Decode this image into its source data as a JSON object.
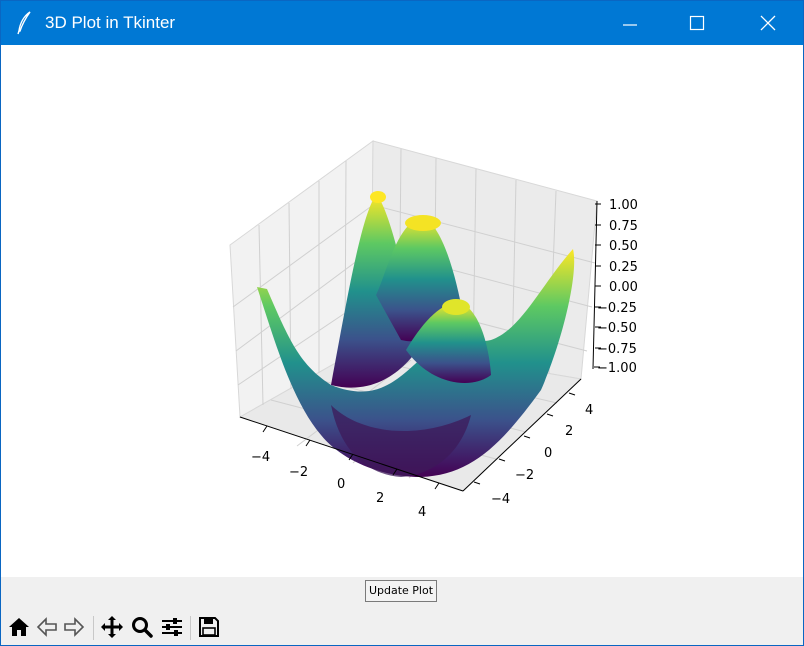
{
  "window": {
    "title": "3D Plot in Tkinter"
  },
  "colors": {
    "titlebar": "#0078d4",
    "viridis_low": "#440154",
    "viridis_mid": "#21918c",
    "viridis_high": "#fde725"
  },
  "plot": {
    "z_ticks": [
      "1.00",
      "0.75",
      "0.50",
      "0.25",
      "0.00",
      "−0.25",
      "−0.50",
      "−0.75",
      "−1.00"
    ],
    "x_ticks": [
      "−4",
      "−2",
      "0",
      "2",
      "4"
    ],
    "y_ticks": [
      "4",
      "2",
      "0",
      "−2",
      "−4"
    ]
  },
  "chart_data": {
    "type": "surface",
    "function": "z = sin(sqrt(x^2 + y^2))",
    "x_range": [
      -5,
      5
    ],
    "y_range": [
      -5,
      5
    ],
    "z_range": [
      -1,
      1
    ],
    "colormap": "viridis",
    "x_ticks": [
      -4,
      -2,
      0,
      2,
      4
    ],
    "y_ticks": [
      -4,
      -2,
      0,
      2,
      4
    ],
    "z_ticks": [
      -1.0,
      -0.75,
      -0.5,
      -0.25,
      0.0,
      0.25,
      0.5,
      0.75,
      1.0
    ],
    "grid": true
  },
  "controls": {
    "update_label": "Update Plot"
  },
  "toolbar": {
    "buttons": [
      "home-icon",
      "back-icon",
      "forward-icon",
      "pan-icon",
      "zoom-icon",
      "configure-icon",
      "save-icon"
    ]
  }
}
